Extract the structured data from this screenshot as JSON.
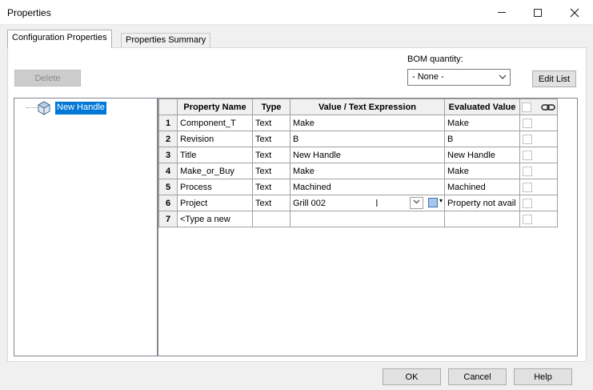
{
  "window": {
    "title": "Properties"
  },
  "tabs": [
    {
      "label": "Configuration Properties",
      "active": true
    },
    {
      "label": "Properties Summary",
      "active": false
    }
  ],
  "toolbar": {
    "delete_label": "Delete",
    "edit_list_label": "Edit List"
  },
  "bom": {
    "label": "BOM quantity:",
    "value": "- None -"
  },
  "tree": {
    "root_label": "New Handle"
  },
  "grid": {
    "columns": [
      "Property Name",
      "Type",
      "Value / Text Expression",
      "Evaluated Value"
    ],
    "rows": [
      {
        "num": "1",
        "name": "Component_T",
        "type": "Text",
        "value": "Make",
        "evaluated": "Make"
      },
      {
        "num": "2",
        "name": "Revision",
        "type": "Text",
        "value": "B",
        "evaluated": "B"
      },
      {
        "num": "3",
        "name": "Title",
        "type": "Text",
        "value": "New Handle",
        "evaluated": "New Handle"
      },
      {
        "num": "4",
        "name": "Make_or_Buy",
        "type": "Text",
        "value": "Make",
        "evaluated": "Make"
      },
      {
        "num": "5",
        "name": "Process",
        "type": "Text",
        "value": "Machined",
        "evaluated": "Machined"
      },
      {
        "num": "6",
        "name": "Project",
        "type": "Text",
        "value": "Grill 002",
        "evaluated": "Property not avail"
      },
      {
        "num": "7",
        "name": "<Type a new",
        "type": "",
        "value": "",
        "evaluated": ""
      }
    ]
  },
  "buttons": {
    "ok": "OK",
    "cancel": "Cancel",
    "help": "Help"
  },
  "colors": {
    "selection": "#0078d7",
    "panel": "#ffffff",
    "chrome": "#f0f0f0"
  },
  "icons": [
    "minimize-icon",
    "maximize-icon",
    "close-icon",
    "part-icon",
    "link-icon",
    "chevron-down-icon",
    "ibeam-cursor-icon"
  ]
}
